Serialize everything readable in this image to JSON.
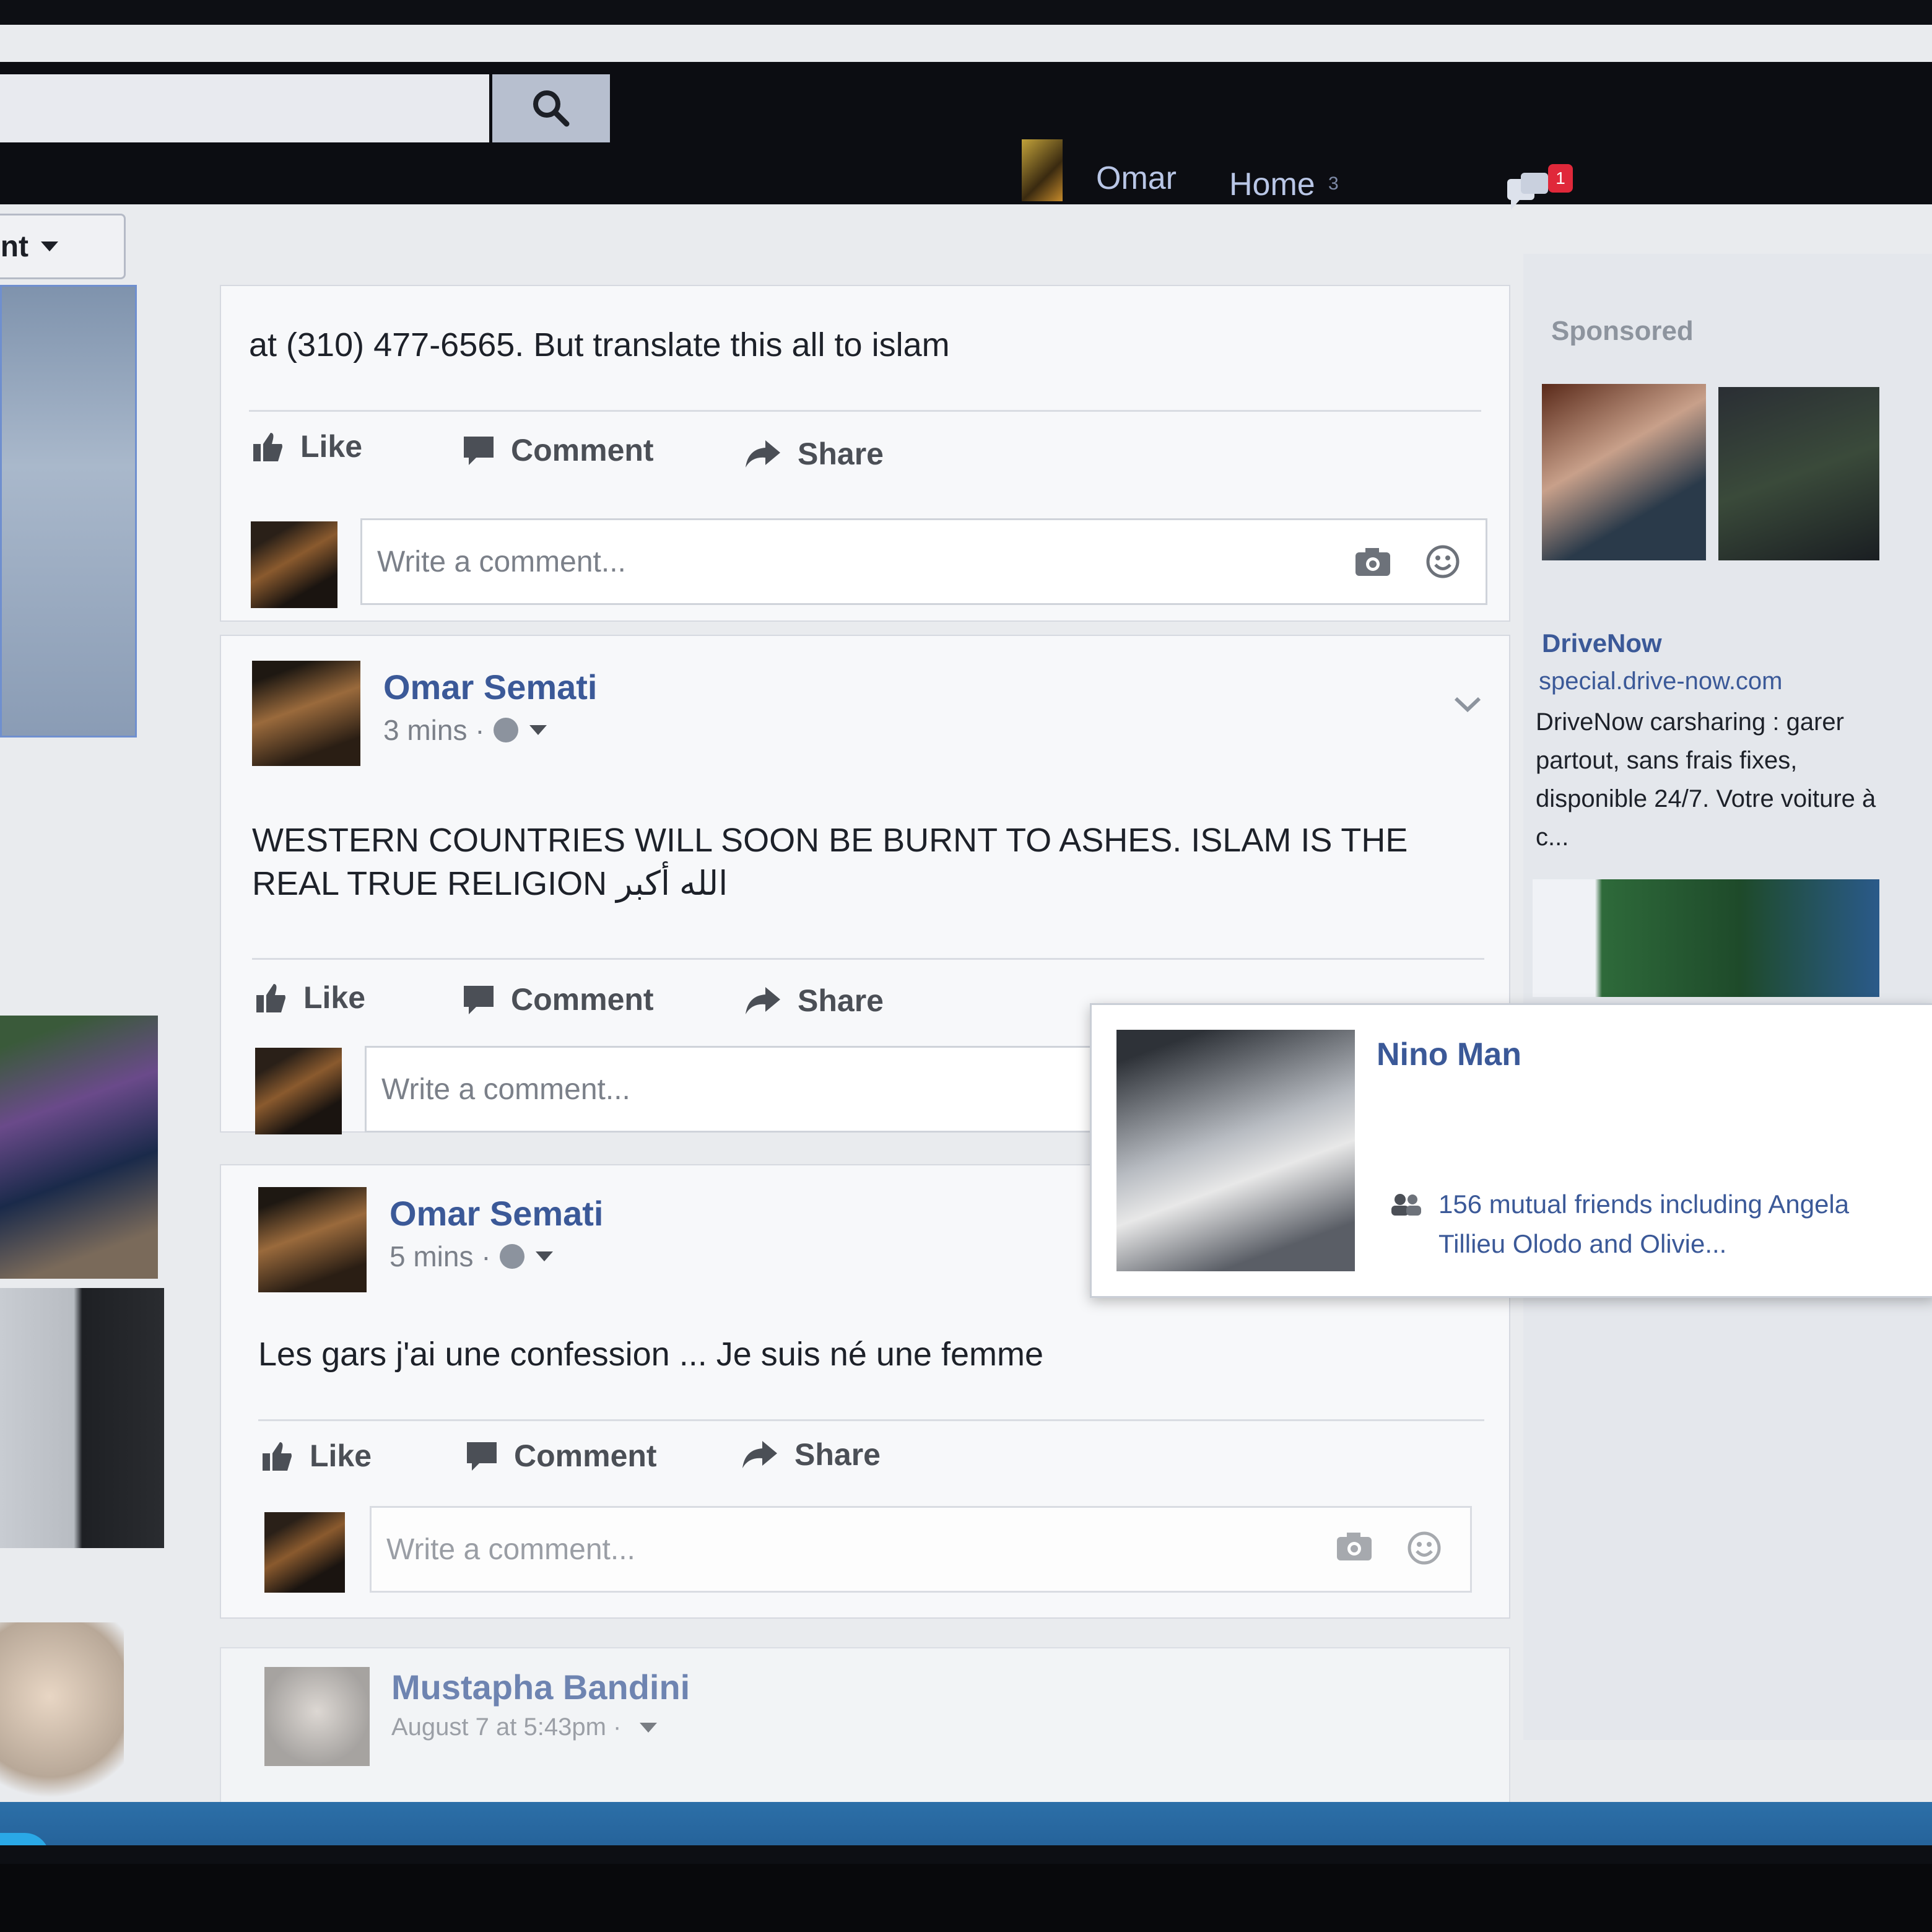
{
  "topbar": {
    "search_icon": "search-icon",
    "nav_user": "Omar",
    "nav_home": "Home",
    "nav_home_count": "3",
    "notification_badge": "1"
  },
  "sort_button": {
    "label": "ent"
  },
  "posts": [
    {
      "text": "at (310) 477-6565. But translate this all to islam",
      "actions": {
        "like": "Like",
        "comment": "Comment",
        "share": "Share"
      },
      "comment_placeholder": "Write a comment..."
    },
    {
      "author": "Omar Semati",
      "time": "3 mins ·",
      "text": "WESTERN COUNTRIES WILL SOON BE BURNT TO ASHES. ISLAM IS THE REAL TRUE RELIGION الله أكبر",
      "actions": {
        "like": "Like",
        "comment": "Comment",
        "share": "Share"
      },
      "comment_placeholder": "Write a comment..."
    },
    {
      "author": "Omar Semati",
      "time": "5 mins ·",
      "text": "Les gars j'ai une confession ... Je suis né une femme",
      "actions": {
        "like": "Like",
        "comment": "Comment",
        "share": "Share"
      },
      "comment_placeholder": "Write a comment..."
    },
    {
      "author": "Mustapha Bandini",
      "time": "August 7 at 5:43pm ·"
    }
  ],
  "sidebar": {
    "sponsored": "Sponsored",
    "ad": {
      "name": "DriveNow",
      "url": "special.drive-now.com",
      "description": "DriveNow carsharing : garer partout, sans frais fixes, disponible 24/7. Votre voiture à c..."
    }
  },
  "hovercard": {
    "name": "Nino Man",
    "mutual": "156 mutual friends including Angela Tillieu Olodo and Olivie..."
  },
  "colors": {
    "link": "#3b5998",
    "topbar": "#0c0d12",
    "badge": "#e0283a"
  }
}
